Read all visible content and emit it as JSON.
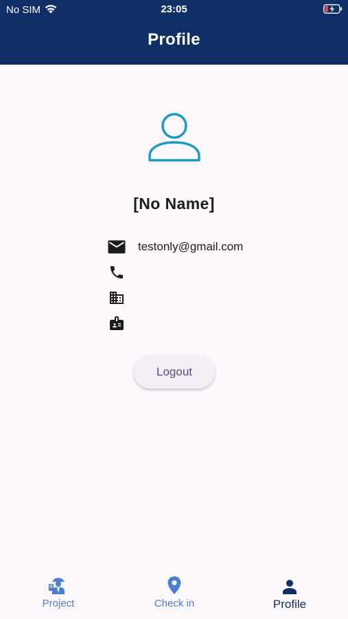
{
  "status_bar": {
    "carrier": "No SIM",
    "time": "23:05",
    "wifi_icon": "wifi-icon",
    "battery_icon": "battery-charging-icon"
  },
  "header": {
    "title": "Profile",
    "background": "#0f2f66"
  },
  "profile": {
    "avatar_icon": "person-outline-icon",
    "name": "[No Name]",
    "email": "testonly@gmail.com",
    "phone": "",
    "company": "",
    "badge": ""
  },
  "actions": {
    "logout_label": "Logout"
  },
  "tabs": [
    {
      "label": "Project",
      "icon": "worker-icon",
      "active": false
    },
    {
      "label": "Check in",
      "icon": "location-pin-icon",
      "active": false
    },
    {
      "label": "Profile",
      "icon": "person-icon",
      "active": true
    }
  ],
  "colors": {
    "accent": "#1a9bc7",
    "tab_inactive": "#4a7fd1",
    "tab_active": "#0f2f66",
    "page_bg": "#fdf8fb"
  }
}
